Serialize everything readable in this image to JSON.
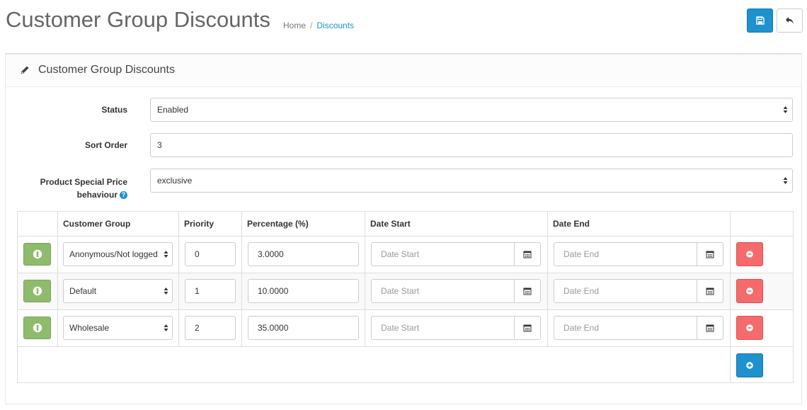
{
  "header": {
    "title": "Customer Group Discounts",
    "breadcrumb": [
      {
        "label": "Home"
      },
      {
        "label": "Discounts"
      }
    ],
    "breadcrumb_separator": "/",
    "save_icon": "save-icon",
    "back_icon": "reply-icon"
  },
  "panel": {
    "title": "Customer Group Discounts",
    "title_icon": "pencil-icon"
  },
  "form": {
    "status": {
      "label": "Status",
      "value": "Enabled"
    },
    "sort_order": {
      "label": "Sort Order",
      "value": "3"
    },
    "special_price": {
      "label_line1": "Product Special Price",
      "label_line2": "behaviour",
      "value": "exclusive"
    }
  },
  "table": {
    "headers": [
      "Customer Group",
      "Priority",
      "Percentage (%)",
      "Date Start",
      "Date End"
    ],
    "rows": [
      {
        "group": "Anonymous/Not logged",
        "priority": "0",
        "percentage": "3.0000",
        "date_start_placeholder": "Date Start",
        "date_end_placeholder": "Date End"
      },
      {
        "group": "Default",
        "priority": "1",
        "percentage": "10.0000",
        "date_start_placeholder": "Date Start",
        "date_end_placeholder": "Date End"
      },
      {
        "group": "Wholesale",
        "priority": "2",
        "percentage": "35.0000",
        "date_start_placeholder": "Date Start",
        "date_end_placeholder": "Date End"
      }
    ]
  },
  "colors": {
    "primary": "#1e91cf",
    "success": "#8fbb6c",
    "danger": "#f56b6b"
  }
}
